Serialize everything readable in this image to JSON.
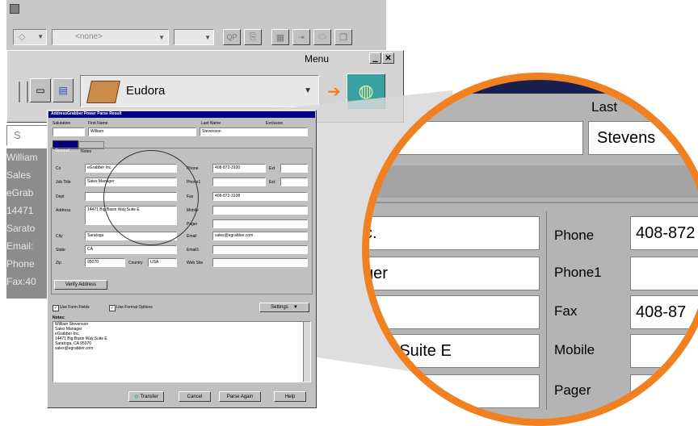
{
  "toolbar": {
    "style_value": "<none>",
    "size_value": "",
    "qp_label": "QP",
    "menu_label": "Menu",
    "app_selected": "Eudora"
  },
  "background": {
    "s_field": "S",
    "lines": [
      "William",
      "Sales",
      "eGrab",
      "14471",
      "Sarato",
      "Email:",
      "Phone",
      "Fax:40"
    ]
  },
  "dialog": {
    "title": "AddressGrabber Power Parse Result",
    "header_labels": [
      "Salutation",
      "First Name",
      "Last Name"
    ],
    "first_name": "William",
    "last_name": "Stevenson",
    "tabs": [
      "General",
      "Notes"
    ],
    "left_labels": [
      "Co",
      "Job Title",
      "Dept",
      "Address",
      "City",
      "State",
      "Zip"
    ],
    "company": "eGrabber Inc.",
    "job_title": "Sales Manager",
    "dept": "",
    "address": "14471 Big Basin Way,Suite E",
    "city": "Saratoga",
    "state": "CA",
    "zip": "95070",
    "country_label": "Country",
    "country": "USA",
    "right_labels": [
      "Phone",
      "Phone1",
      "Fax",
      "Mobile",
      "Pager",
      "Email",
      "Email1",
      "Web Site"
    ],
    "phone": "408-872-3100",
    "phone1": "",
    "fax": "408-872-3108",
    "email": "sales@egrabber.com",
    "ext_label": "Ext",
    "verify_button": "Verify Address",
    "use_form_fields": "Use Form Fields",
    "use_format_options": "Use Format Options",
    "settings_button": "Settings",
    "notes_label": "Notes:",
    "notes_lines": [
      "William Stevenson",
      "Sales Manager",
      "eGrabber Inc.",
      "14471 Big Basin Way,Suite E",
      "Saratoga, CA 95070",
      "sales@egrabber.com"
    ],
    "buttons": [
      "Transfer",
      "Cancel",
      "Parse Again",
      "Help"
    ]
  },
  "zoom": {
    "last_label": "Last",
    "last_name_value": "Stevens",
    "left_values": [
      "c.",
      "ger",
      "",
      "Way,Suite E",
      ""
    ],
    "right_labels": [
      "Phone",
      "Phone1",
      "Fax",
      "Mobile",
      "Pager"
    ],
    "right_values": [
      "408-872",
      "",
      "408-87",
      "",
      ""
    ]
  },
  "colors": {
    "accent_orange": "#f08020",
    "titlebar": "#000080",
    "window_gray": "#c0c0c0",
    "zoom_gray": "#b4b4b4"
  }
}
